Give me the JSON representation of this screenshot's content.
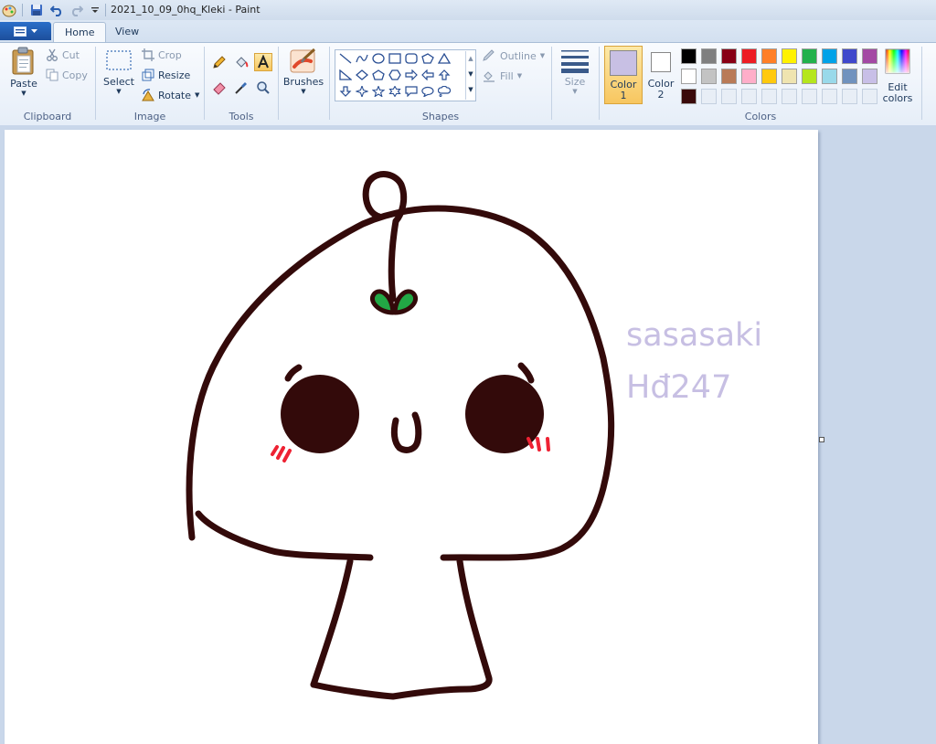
{
  "window": {
    "title": "2021_10_09_0hq_Kleki - Paint"
  },
  "tabs": [
    {
      "label": "Home"
    },
    {
      "label": "View"
    }
  ],
  "clipboard": {
    "group": "Clipboard",
    "paste": "Paste",
    "cut": "Cut",
    "copy": "Copy"
  },
  "image": {
    "group": "Image",
    "select": "Select",
    "crop": "Crop",
    "resize": "Resize",
    "rotate": "Rotate"
  },
  "tools": {
    "group": "Tools"
  },
  "brushes": {
    "label": "Brushes"
  },
  "shapes": {
    "group": "Shapes",
    "outline": "Outline",
    "fill": "Fill"
  },
  "size": {
    "label": "Size"
  },
  "colors": {
    "group": "Colors",
    "color1_label": "Color",
    "color1_num": "1",
    "color2_label": "Color",
    "color2_num": "2",
    "edit_label": "Edit",
    "edit_label2": "colors",
    "color1_value": "#c8c0e4",
    "color2_value": "#ffffff",
    "palette": [
      "#000000",
      "#7f7f7f",
      "#880015",
      "#ed1c24",
      "#ff7f27",
      "#fff200",
      "#22b14c",
      "#00a2e8",
      "#3f48cc",
      "#a349a4",
      "#ffffff",
      "#c3c3c3",
      "#b97a57",
      "#ffaec9",
      "#ffc90e",
      "#efe4b0",
      "#b5e61d",
      "#99d9ea",
      "#7092be",
      "#c8bfe7",
      "#3a0a0a"
    ]
  },
  "canvas": {
    "watermark_line1": "sasasaki",
    "watermark_line2": "Hđ247",
    "stroke_color": "#330a0a",
    "leaf_color": "#22a845",
    "blush_color": "#ee2233"
  }
}
